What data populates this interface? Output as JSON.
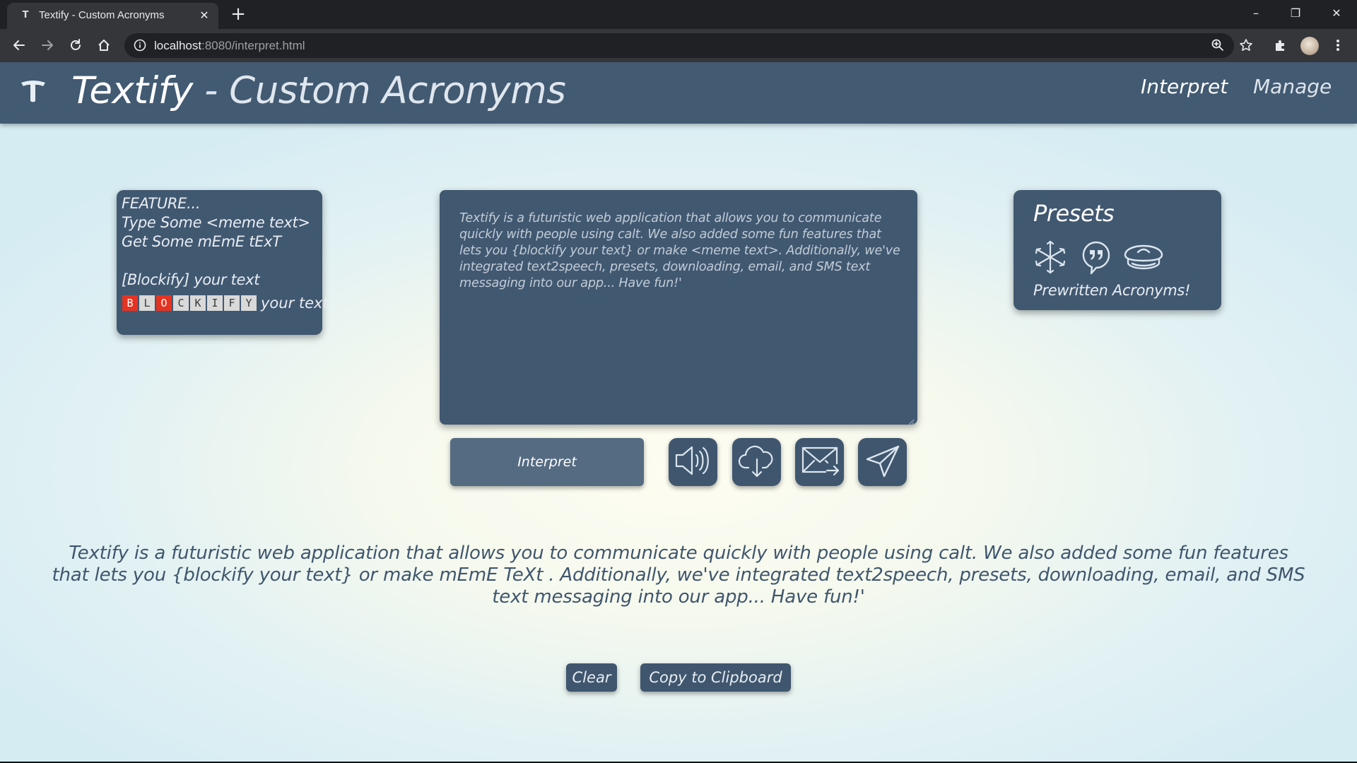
{
  "browser": {
    "tab_title": "Textify - Custom Acronyms",
    "tab_favicon": "T",
    "tab_close_glyph": "✕",
    "new_tab_glyph": "+",
    "url_host": "localhost",
    "url_path": ":8080/interpret.html",
    "window_controls": {
      "minimize": "–",
      "restore": "❐",
      "close": "✕"
    },
    "icons": [
      "back-arrow-icon",
      "forward-arrow-icon",
      "reload-icon",
      "home-icon",
      "info-icon",
      "zoom-icon",
      "star-icon",
      "extensions-icon",
      "profile-avatar",
      "kebab-menu-icon"
    ]
  },
  "header": {
    "brand": "Textify",
    "brand_suffix": " - Custom Acronyms",
    "nav": {
      "interpret": "Interpret",
      "manage": "Manage"
    }
  },
  "feature": {
    "lines": [
      "FEATURE...",
      "Type Some <meme text>",
      "Get Some mEmE tExT",
      "[Blockify] your text"
    ],
    "blocky_letters": [
      {
        "char": "B",
        "red": true
      },
      {
        "char": "L",
        "red": false
      },
      {
        "char": "O",
        "red": true
      },
      {
        "char": "C",
        "red": false
      },
      {
        "char": "K",
        "red": false
      },
      {
        "char": "I",
        "red": false
      },
      {
        "char": "F",
        "red": false
      },
      {
        "char": "Y",
        "red": false
      }
    ],
    "blocky_suffix": "your text",
    "colors": {
      "red_block": "#e53322",
      "gray_block": "#d9d9d9"
    }
  },
  "input": {
    "text": "Textify is a futuristic web application that allows you to communicate quickly with people using calt. We also added some fun features that lets you {blockify your text} or make <meme text>. Additionally, we've integrated text2speech, presets, downloading, email, and SMS text messaging into our app... Have fun!'"
  },
  "presets": {
    "title": "Presets",
    "icons": [
      "medical-asterisk-icon",
      "quote-bubble-icon",
      "captain-hat-icon"
    ],
    "caption": "Prewritten Acronyms!"
  },
  "actions": {
    "interpret_label": "Interpret",
    "icons": [
      "speaker-icon",
      "cloud-download-icon",
      "email-icon",
      "paper-plane-icon"
    ]
  },
  "output": {
    "text": "Textify is a futuristic web application that allows you to communicate quickly with people using calt. We also added some fun features that lets you {blockify your text} or make mEmE TeXt . Additionally, we've integrated text2speech, presets, downloading, email, and SMS text messaging into our app... Have fun!'"
  },
  "buttons": {
    "clear": "Clear",
    "copy": "Copy to Clipboard"
  },
  "colors": {
    "navbar": "#425a72",
    "card": "#415871",
    "accent_text": "#3f566e",
    "browser_dark": "#202124",
    "browser_toolbar": "#35363a"
  }
}
